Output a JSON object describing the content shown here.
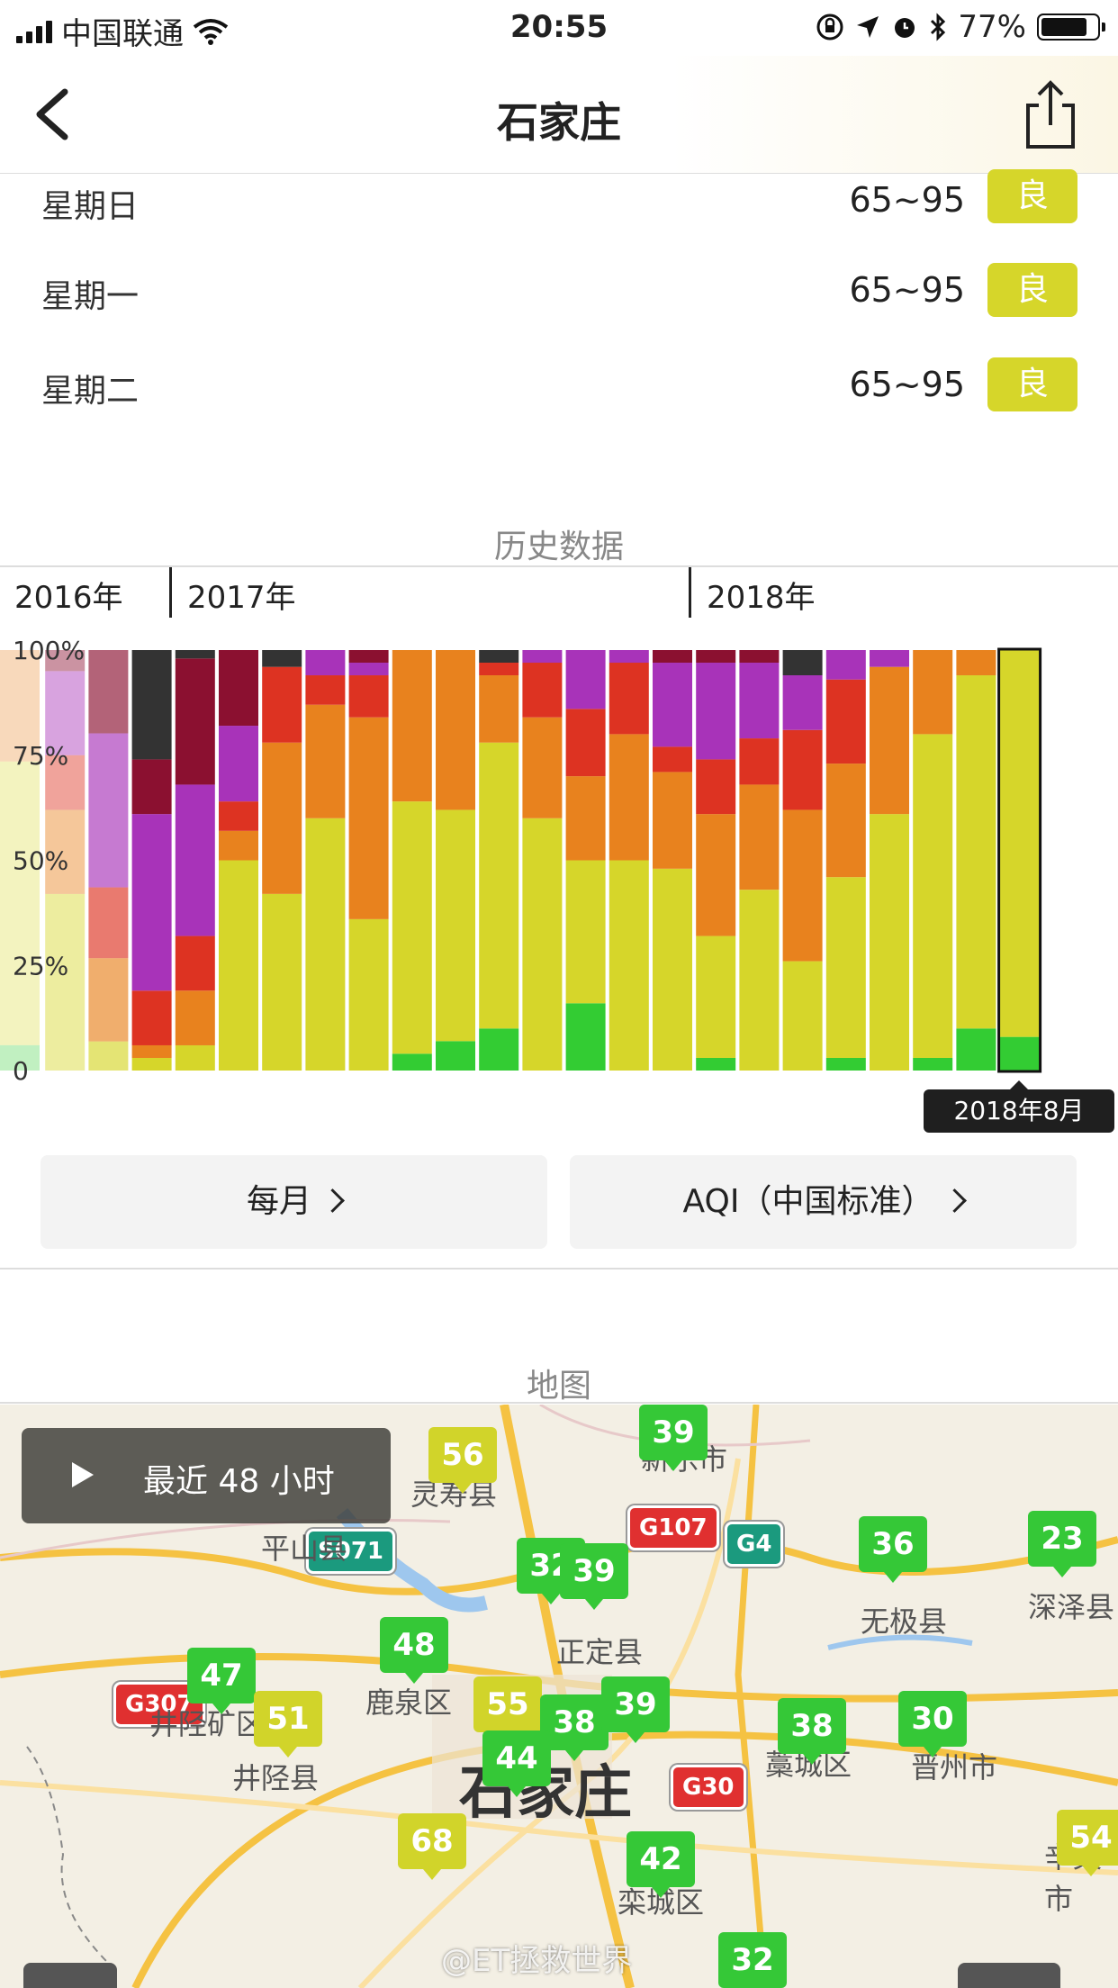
{
  "status_bar": {
    "carrier": "中国联通",
    "time": "20:55",
    "battery": "77%"
  },
  "nav": {
    "title": "石家庄"
  },
  "forecast": [
    {
      "day": "星期日",
      "range": "65~95",
      "level": "良"
    },
    {
      "day": "星期一",
      "range": "65~95",
      "level": "良"
    },
    {
      "day": "星期二",
      "range": "65~95",
      "level": "良"
    }
  ],
  "history": {
    "section_title": "历史数据",
    "years": [
      "2016年",
      "2017年",
      "2018年"
    ],
    "tooltip": "2018年8月",
    "buttons": {
      "period": "每月",
      "standard": "AQI（中国标准）"
    }
  },
  "chart_data": {
    "type": "bar",
    "stacked": true,
    "percent": true,
    "ylim": [
      0,
      100
    ],
    "yticks": [
      "0",
      "25%",
      "50%",
      "75%",
      "100%"
    ],
    "level_colors": [
      "#33cc33",
      "#d6d62a",
      "#e8821e",
      "#dd3322",
      "#a833b9",
      "#8b1030",
      "#333333"
    ],
    "levels": [
      "优",
      "良",
      "轻度",
      "中度",
      "重度",
      "严重",
      "爆表"
    ],
    "highlight_index": 23,
    "bars": [
      [
        5,
        56,
        22,
        0,
        0,
        0,
        0
      ],
      [
        0,
        42,
        20,
        13,
        20,
        5,
        0
      ],
      [
        0,
        7,
        20,
        17,
        37,
        20,
        0
      ],
      [
        0,
        3,
        3,
        13,
        42,
        13,
        26
      ],
      [
        0,
        6,
        13,
        13,
        36,
        30,
        2
      ],
      [
        0,
        50,
        7,
        7,
        18,
        18,
        0
      ],
      [
        0,
        42,
        36,
        18,
        0,
        0,
        4
      ],
      [
        0,
        60,
        27,
        7,
        6,
        0,
        0
      ],
      [
        0,
        36,
        48,
        10,
        3,
        3,
        0
      ],
      [
        4,
        60,
        36,
        0,
        0,
        0,
        0
      ],
      [
        7,
        55,
        38,
        0,
        0,
        0,
        0
      ],
      [
        10,
        68,
        16,
        3,
        0,
        0,
        3
      ],
      [
        0,
        60,
        24,
        13,
        3,
        0,
        0
      ],
      [
        16,
        34,
        20,
        16,
        14,
        0,
        0
      ],
      [
        0,
        50,
        30,
        17,
        3,
        0,
        0
      ],
      [
        0,
        48,
        23,
        6,
        20,
        3,
        0
      ],
      [
        3,
        29,
        29,
        13,
        23,
        3,
        0
      ],
      [
        0,
        43,
        25,
        11,
        18,
        3,
        0
      ],
      [
        0,
        26,
        36,
        19,
        13,
        0,
        6
      ],
      [
        3,
        43,
        27,
        20,
        7,
        0,
        0
      ],
      [
        0,
        61,
        35,
        0,
        4,
        0,
        0
      ],
      [
        3,
        77,
        20,
        0,
        0,
        0,
        0
      ],
      [
        10,
        84,
        6,
        0,
        0,
        0,
        0
      ],
      [
        8,
        92,
        0,
        0,
        0,
        0,
        0
      ]
    ]
  },
  "map": {
    "section_title": "地图",
    "play_label": "最近 48 小时",
    "city": "石家庄",
    "markers": [
      {
        "value": "56",
        "level": "yellow"
      },
      {
        "value": "39",
        "level": "green"
      },
      {
        "value": "32",
        "level": "green"
      },
      {
        "value": "39",
        "level": "green"
      },
      {
        "value": "36",
        "level": "green"
      },
      {
        "value": "23",
        "level": "green"
      },
      {
        "value": "47",
        "level": "green"
      },
      {
        "value": "48",
        "level": "green"
      },
      {
        "value": "51",
        "level": "yellow"
      },
      {
        "value": "55",
        "level": "yellow"
      },
      {
        "value": "38",
        "level": "green"
      },
      {
        "value": "39",
        "level": "green"
      },
      {
        "value": "38",
        "level": "green"
      },
      {
        "value": "30",
        "level": "green"
      },
      {
        "value": "44",
        "level": "green"
      },
      {
        "value": "54",
        "level": "yellow"
      },
      {
        "value": "68",
        "level": "yellow"
      },
      {
        "value": "42",
        "level": "green"
      },
      {
        "value": "32",
        "level": "green"
      }
    ],
    "places": [
      "灵寿县",
      "新乐市",
      "平山县",
      "正定县",
      "无极县",
      "深泽县",
      "井陉矿区",
      "鹿泉区",
      "井陉县",
      "藁城区",
      "晋州市",
      "辛集市",
      "栾城区"
    ],
    "roads": [
      "G107",
      "S071",
      "G4",
      "G307",
      "G30"
    ],
    "watermark": "@ET拯救世界"
  }
}
